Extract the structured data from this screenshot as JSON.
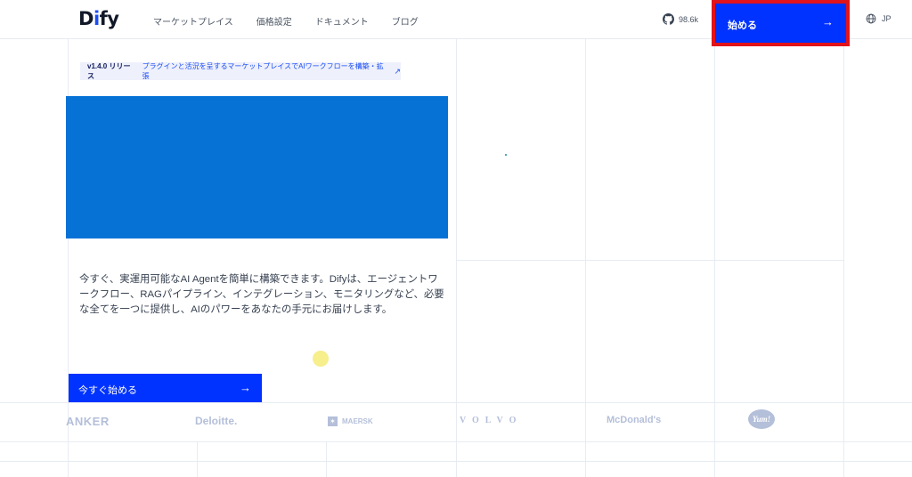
{
  "header": {
    "logo_prefix": "D",
    "logo_accent": "i",
    "logo_suffix": "fy",
    "nav": [
      "マーケットプレイス",
      "価格設定",
      "ドキュメント",
      "ブログ"
    ],
    "github_stars": "98.6k",
    "cta_label": "始める",
    "lang": "JP"
  },
  "release": {
    "version": "v1.4.0 リリース",
    "description": "プラグインと活況を呈するマーケットプレイスでAIワークフローを構築・拡張"
  },
  "hero": {
    "color": "#0672d6",
    "description": "今すぐ、実運用可能なAI Agentを簡単に構築できます。Difyは、エージェントワークフロー、RAGパイプライン、インテグレーション、モニタリングなど、必要な全てを一つに提供し、AIのパワーをあなたの手元にお届けします。",
    "start_button": "今すぐ始める"
  },
  "logos": [
    "ANKER",
    "Deloitte.",
    "MAERSK",
    "VOLVO",
    "McDonald's",
    "Yum!"
  ],
  "colors": {
    "accent": "#0033ff",
    "highlight_border": "#e1131b"
  },
  "icons": {
    "github": "github-icon",
    "arrow": "arrow-right-icon",
    "globe": "globe-icon",
    "external": "external-link-icon"
  }
}
